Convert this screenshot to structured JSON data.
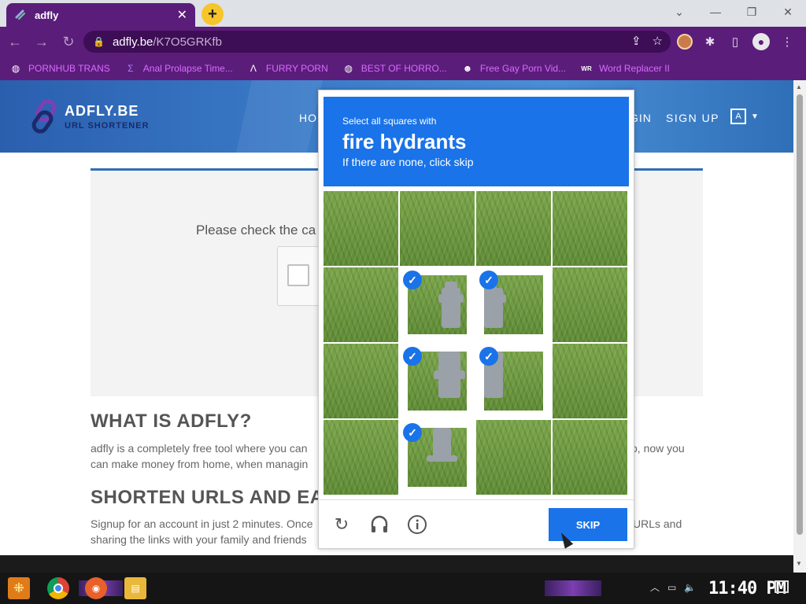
{
  "browser": {
    "tab_title": "adfly",
    "url_host": "adfly.be",
    "url_path": "/K7O5GRKfb",
    "bookmarks": [
      {
        "label": "PORNHUB TRANS",
        "icon": "globe-icon"
      },
      {
        "label": "Anal Prolapse Time...",
        "icon": "sigma-icon"
      },
      {
        "label": "FURRY PORN",
        "icon": "arrow-a-icon"
      },
      {
        "label": "BEST OF HORRO...",
        "icon": "globe-icon"
      },
      {
        "label": "Free Gay Porn Vid...",
        "icon": "mascot-icon"
      },
      {
        "label": "Word Replacer II",
        "icon": "wr-icon"
      }
    ]
  },
  "site": {
    "logo_title": "ADFLY.BE",
    "logo_sub": "URL SHORTENER",
    "nav_home": "HO",
    "nav_login": "GIN",
    "nav_signup": "SIGN UP",
    "card_text": "Please check the ca",
    "what_heading": "WHAT IS ADFLY?",
    "what_para_1": "adfly is a completely free tool where you can",
    "what_para_1_right": "o, now you",
    "what_para_2": "can make money from home, when managin",
    "shorten_heading": "SHORTEN URLS AND EA",
    "shorten_para_1": "Signup for an account in just 2 minutes. Once",
    "shorten_para_1_right": "URLs and",
    "shorten_para_2": "sharing the links with your family and friends"
  },
  "captcha": {
    "line1": "Select all squares with",
    "line2": "fire hydrants",
    "line3": "If there are none, click skip",
    "skip_label": "SKIP",
    "tiles": [
      [
        false,
        false,
        false,
        false
      ],
      [
        false,
        true,
        true,
        false
      ],
      [
        false,
        true,
        true,
        false
      ],
      [
        false,
        true,
        false,
        false
      ]
    ],
    "accent": "#1a73e8"
  },
  "taskbar": {
    "clock": "11:40 PM"
  }
}
